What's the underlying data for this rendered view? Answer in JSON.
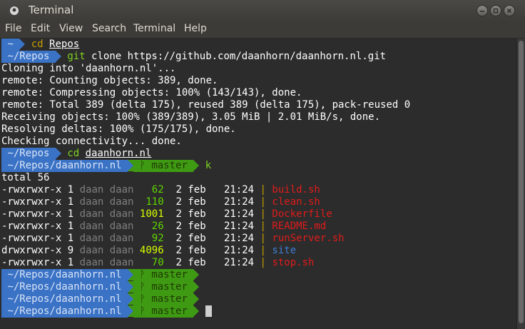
{
  "window": {
    "title": "Terminal"
  },
  "menu": [
    "File",
    "Edit",
    "View",
    "Search",
    "Terminal",
    "Help"
  ],
  "prompt": {
    "home": "~",
    "repos": "~/Repos",
    "repo_dir": "~/Repos/daanhorn.nl",
    "branch_icon": "ᚹ",
    "branch": "master"
  },
  "commands": {
    "cd_repos": "cd",
    "cd_repos_arg": "Repos",
    "git": "git",
    "git_rest": " clone https://github.com/daanhorn/daanhorn.nl.git",
    "cd_site": "cd",
    "cd_site_arg": "daanhorn.nl",
    "k": "k"
  },
  "output": [
    "Cloning into 'daanhorn.nl'...",
    "remote: Counting objects: 389, done.",
    "remote: Compressing objects: 100% (143/143), done.",
    "remote: Total 389 (delta 175), reused 389 (delta 175), pack-reused 0",
    "Receiving objects: 100% (389/389), 3.05 MiB | 2.01 MiB/s, done.",
    "Resolving deltas: 100% (175/175), done.",
    "Checking connectivity... done."
  ],
  "listing": {
    "total": "total 56",
    "rows": [
      {
        "perm": "-rwxrwxr-x",
        "links": "1",
        "owner": "daan daan",
        "size": "  62",
        "date": "2 feb",
        "time": "21:24",
        "name": "build.sh",
        "kind": "red"
      },
      {
        "perm": "-rwxrwxr-x",
        "links": "1",
        "owner": "daan daan",
        "size": " 110",
        "date": "2 feb",
        "time": "21:24",
        "name": "clean.sh",
        "kind": "red"
      },
      {
        "perm": "-rwxrwxr-x",
        "links": "1",
        "owner": "daan daan",
        "size": "1001",
        "date": "2 feb",
        "time": "21:24",
        "name": "Dockerfile",
        "kind": "red"
      },
      {
        "perm": "-rwxrwxr-x",
        "links": "1",
        "owner": "daan daan",
        "size": "  26",
        "date": "2 feb",
        "time": "21:24",
        "name": "README.md",
        "kind": "red"
      },
      {
        "perm": "-rwxrwxr-x",
        "links": "1",
        "owner": "daan daan",
        "size": "  92",
        "date": "2 feb",
        "time": "21:24",
        "name": "runServer.sh",
        "kind": "red"
      },
      {
        "perm": "drwxrwxr-x",
        "links": "9",
        "owner": "daan daan",
        "size": "4096",
        "date": "2 feb",
        "time": "21:24",
        "name": "site",
        "kind": "blue"
      },
      {
        "perm": "-rwxrwxr-x",
        "links": "1",
        "owner": "daan daan",
        "size": "  70",
        "date": "2 feb",
        "time": "21:24",
        "name": "stop.sh",
        "kind": "red"
      }
    ]
  },
  "colors": {
    "prompt_blue": "#3a72c6",
    "prompt_green": "#3f9a13",
    "background": "#2c2c2c"
  }
}
